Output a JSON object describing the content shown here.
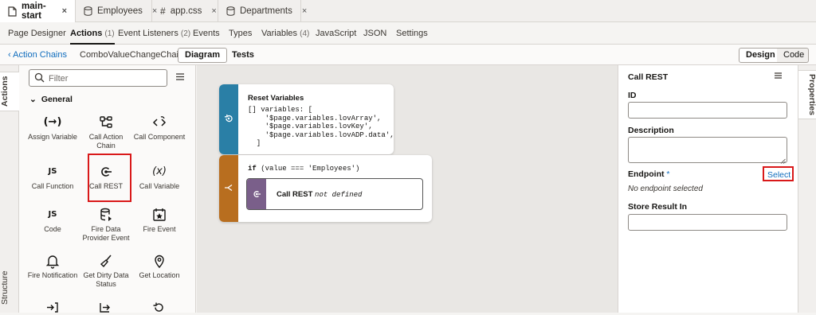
{
  "colors": {
    "accent_red": "#d9191a",
    "reset_block": "#2a7fa6",
    "if_block": "#b86e1f",
    "call_rest_chip": "#7a5f8a",
    "link_blue": "#0f6cbd"
  },
  "file_tabs": [
    {
      "label": "main-start",
      "icon": "file-icon",
      "active": true
    },
    {
      "label": "Employees",
      "icon": "database-icon",
      "active": false
    },
    {
      "label": "app.css",
      "icon": "hash-icon",
      "active": false
    },
    {
      "label": "Departments",
      "icon": "database-icon",
      "active": false
    }
  ],
  "close_glyph": "×",
  "sub_tabs": [
    {
      "label": "Page Designer",
      "count": ""
    },
    {
      "label": "Actions",
      "count": "(1)"
    },
    {
      "label": "Event Listeners",
      "count": "(2)"
    },
    {
      "label": "Events",
      "count": ""
    },
    {
      "label": "Types",
      "count": ""
    },
    {
      "label": "Variables",
      "count": "(4)"
    },
    {
      "label": "JavaScript",
      "count": ""
    },
    {
      "label": "JSON",
      "count": ""
    },
    {
      "label": "Settings",
      "count": ""
    }
  ],
  "chain_bar": {
    "back_label": "Action Chains",
    "chain_name": "ComboValueChangeChain",
    "diagram": "Diagram",
    "tests": "Tests",
    "design": "Design",
    "code": "Code"
  },
  "left_rail": {
    "actions": "Actions",
    "structure": "Structure"
  },
  "right_rail": {
    "properties": "Properties"
  },
  "palette": {
    "filter_placeholder": "Filter",
    "section": "General",
    "items": [
      {
        "label": "Assign Variable",
        "icon": "assign-variable-icon",
        "glyph": "(→)"
      },
      {
        "label": "Call Action Chain",
        "icon": "call-action-chain-icon"
      },
      {
        "label": "Call Component",
        "icon": "call-component-icon"
      },
      {
        "label": "Call Function",
        "icon": "call-function-icon",
        "glyph": "JS"
      },
      {
        "label": "Call REST",
        "icon": "call-rest-icon"
      },
      {
        "label": "Call Variable",
        "icon": "call-variable-icon",
        "glyph": "(x)"
      },
      {
        "label": "Code",
        "icon": "code-icon",
        "glyph": "JS"
      },
      {
        "label": "Fire Data Provider Event",
        "icon": "fire-data-provider-event-icon"
      },
      {
        "label": "Fire Event",
        "icon": "fire-event-icon"
      },
      {
        "label": "Fire Notification",
        "icon": "bell-icon"
      },
      {
        "label": "Get Dirty Data Status",
        "icon": "broom-icon"
      },
      {
        "label": "Get Location",
        "icon": "location-pin-icon"
      }
    ]
  },
  "canvas": {
    "reset": {
      "title": "Reset Variables",
      "code": [
        "[] variables: [",
        "    '$page.variables.lovArray',",
        "    '$page.variables.lovKey',",
        "    '$page.variables.lovADP.data',",
        "  ]"
      ]
    },
    "if": {
      "keyword": "if",
      "condition": "(value === 'Employees')"
    },
    "call_rest": {
      "title": "Call REST",
      "status": "not defined"
    }
  },
  "properties": {
    "title": "Call REST",
    "id_label": "ID",
    "id_value": "",
    "description_label": "Description",
    "description_value": "",
    "endpoint_label": "Endpoint",
    "required_mark": "*",
    "select_link": "Select",
    "endpoint_status": "No endpoint selected",
    "store_label": "Store Result In",
    "store_value": ""
  }
}
